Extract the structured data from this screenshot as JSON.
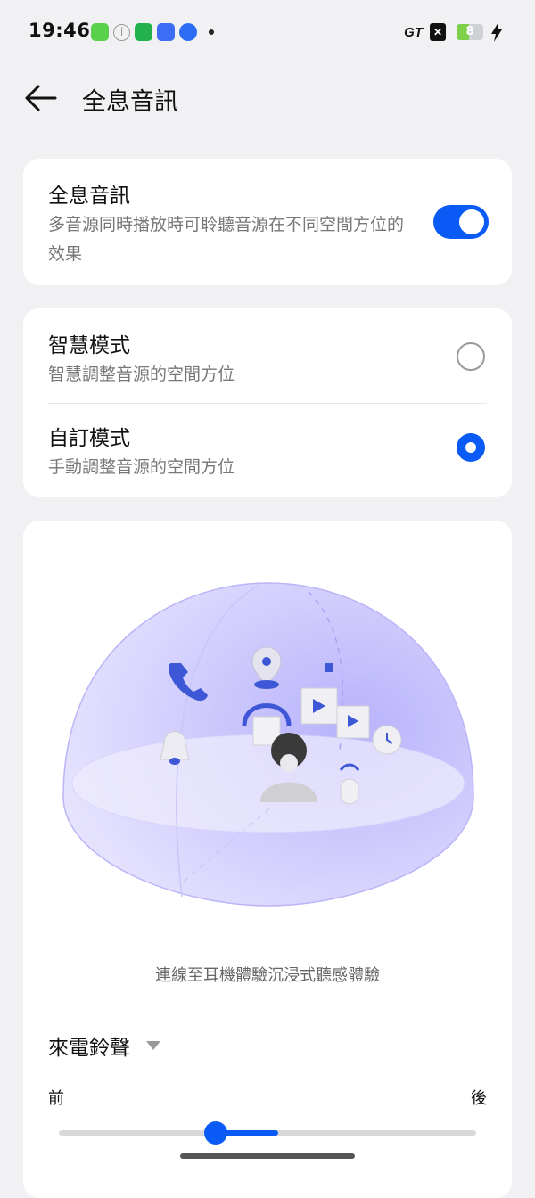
{
  "status_bar": {
    "time": "19:46",
    "network_label": "GT",
    "battery_level": "8",
    "icons": [
      "notification-app-icon",
      "info-icon",
      "upload-icon",
      "app-icon",
      "gt-app-icon",
      "more-dot",
      "network-gt-icon",
      "sim-x-icon",
      "battery-icon",
      "charging-bolt-icon"
    ]
  },
  "header": {
    "title": "全息音訊",
    "back_icon": "arrow-left-icon"
  },
  "master_toggle": {
    "title": "全息音訊",
    "description": "多音源同時播放時可聆聽音源在不同空間方位的效果",
    "enabled": true
  },
  "modes": [
    {
      "title": "智慧模式",
      "description": "智慧調整音源的空間方位",
      "selected": false
    },
    {
      "title": "自訂模式",
      "description": "手動調整音源的空間方位",
      "selected": true
    }
  ],
  "illustration": {
    "caption": "連線至耳機體驗沉浸式聽感體驗"
  },
  "sound_source": {
    "selected": "來電鈴聲",
    "front_label": "前",
    "back_label": "後",
    "slider_position": 0.41
  },
  "colors": {
    "accent": "#0a5bf6",
    "background": "#f1f1f3",
    "card": "#ffffff"
  }
}
